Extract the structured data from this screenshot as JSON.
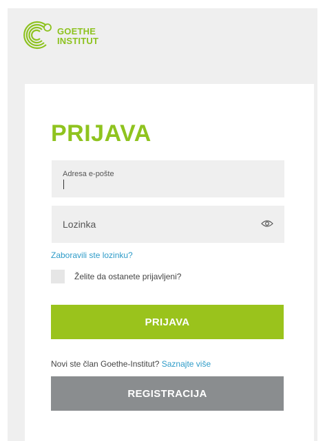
{
  "brand": {
    "line1": "GOETHE",
    "line2": "INSTITUT",
    "color": "#8dc21f"
  },
  "login": {
    "title": "PRIJAVA",
    "email_label": "Adresa e-pošte",
    "email_value": "",
    "password_label": "Lozinka",
    "password_visibility_icon": "eye-icon",
    "forgot_link": "Zaboravili ste lozinku?",
    "remember_label": "Želite da ostanete prijavljeni?",
    "remember_checked": false,
    "submit_label": "PRIJAVA",
    "new_member_text": "Novi ste član Goethe-Institut?",
    "learn_more_link": "Saznajte više",
    "register_label": "REGISTRACIJA"
  },
  "colors": {
    "accent_green": "#9ac31c",
    "link_blue": "#2d9bc8",
    "register_gray": "#8a8d8f",
    "field_bg": "#efefef"
  }
}
